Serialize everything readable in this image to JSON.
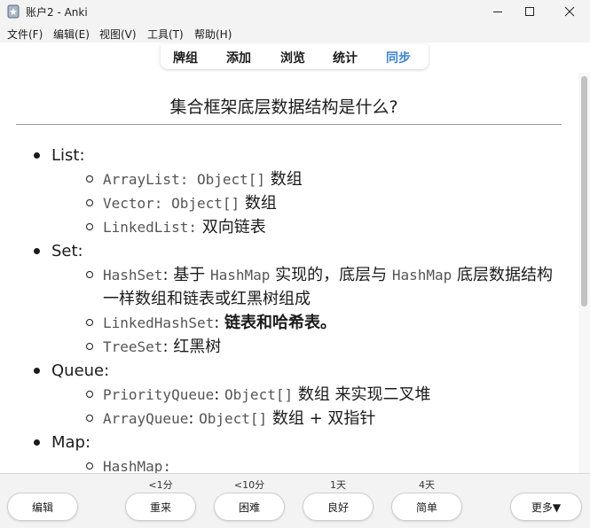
{
  "window": {
    "title": "账户2 - Anki"
  },
  "menu": [
    "文件(F)",
    "编辑(E)",
    "视图(V)",
    "工具(T)",
    "帮助(H)"
  ],
  "toolbar": {
    "items": [
      "牌组",
      "添加",
      "浏览",
      "统计",
      "同步"
    ],
    "active_color": "#3b82d6"
  },
  "card": {
    "question": "集合框架底层数据结构是什么?",
    "list": {
      "list_label": "List:",
      "list_items": [
        {
          "code": "ArrayList: Object[]",
          "text": " 数组"
        },
        {
          "code": "Vector: Object[]",
          "text": " 数组"
        },
        {
          "code": "LinkedList:",
          "text": " 双向链表"
        }
      ],
      "set_label": "Set:",
      "hashset": {
        "code": "HashSet",
        "t1": ": 基于 ",
        "code2": "HashMap",
        "t2": " 实现的，底层与 ",
        "code3": "HashMap",
        "t3": " 底层数据结构一样数组和链表或红黑树组成"
      },
      "linkedhashset": {
        "code": "LinkedHashSet",
        "t1": ": ",
        "bold": "链表和哈希表。"
      },
      "treeset": {
        "code": "TreeSet",
        "t1": ": 红黑树"
      },
      "queue_label": "Queue:",
      "priorityqueue": {
        "code": "PriorityQueue",
        "t1": ": ",
        "code2": "Object[]",
        "t2": " 数组 来实现二叉堆"
      },
      "arrayqueue": {
        "code": "ArrayQueue",
        "t1": ": ",
        "code2": "Object[]",
        "t2": " 数组 + 双指针"
      },
      "map_label": "Map:",
      "hashmap": {
        "code": "HashMap:"
      }
    }
  },
  "answer_bar": {
    "edit": "编辑",
    "more": "更多▼",
    "buttons": [
      {
        "time": "<1分",
        "label": "重来"
      },
      {
        "time": "<10分",
        "label": "困难"
      },
      {
        "time": "1天",
        "label": "良好"
      },
      {
        "time": "4天",
        "label": "简单"
      }
    ]
  }
}
